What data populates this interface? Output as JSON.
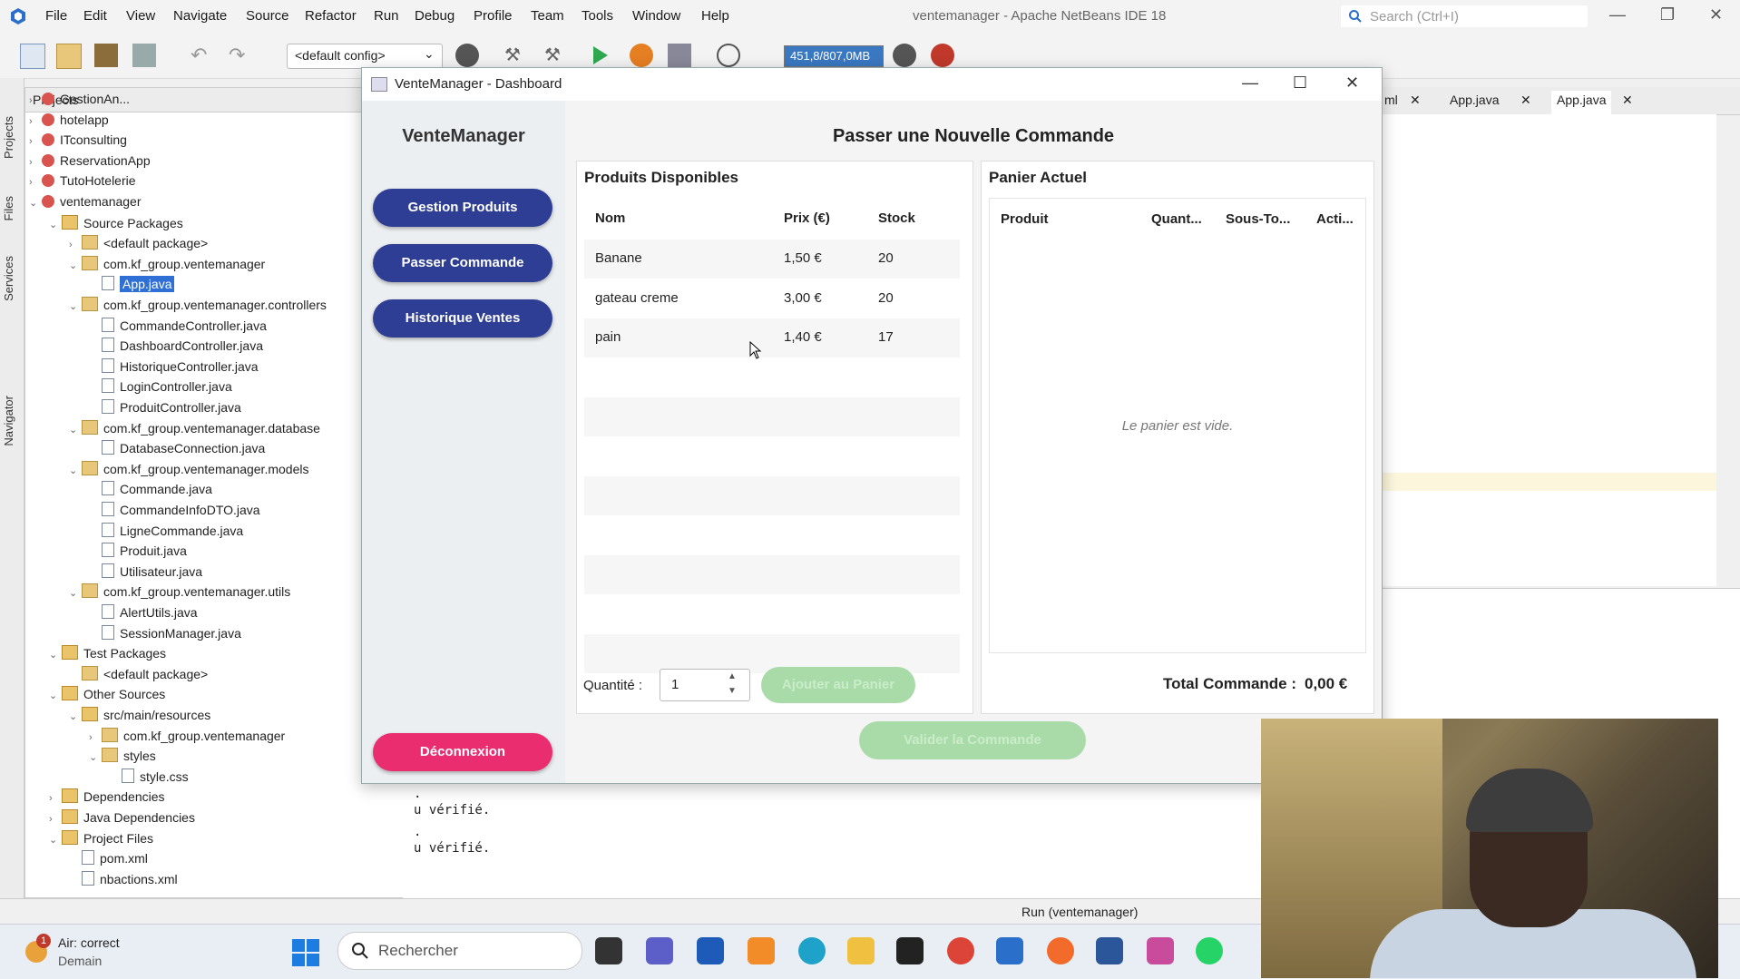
{
  "ide": {
    "title": "ventemanager - Apache NetBeans IDE 18",
    "menus": [
      "File",
      "Edit",
      "View",
      "Navigate",
      "Source",
      "Refactor",
      "Run",
      "Debug",
      "Profile",
      "Team",
      "Tools",
      "Window",
      "Help"
    ],
    "search_placeholder": "Search (Ctrl+I)",
    "config": "<default config>",
    "memory": "451,8/807,0MB",
    "left_tabs": [
      "Projects",
      "Files",
      "Services",
      "Navigator"
    ],
    "projects_header": "Projects",
    "tree": [
      {
        "label": "GestionAn...",
        "indent": 0,
        "icon": "proj",
        "tw": "›"
      },
      {
        "label": "hotelapp",
        "indent": 0,
        "icon": "proj",
        "tw": "›"
      },
      {
        "label": "ITconsulting",
        "indent": 0,
        "icon": "proj",
        "tw": "›"
      },
      {
        "label": "ReservationApp",
        "indent": 0,
        "icon": "proj",
        "tw": "›"
      },
      {
        "label": "TutoHotelerie",
        "indent": 0,
        "icon": "proj",
        "tw": "›"
      },
      {
        "label": "ventemanager",
        "indent": 0,
        "icon": "proj",
        "tw": "⌄"
      },
      {
        "label": "Source Packages",
        "indent": 1,
        "icon": "folder",
        "tw": "⌄"
      },
      {
        "label": "<default package>",
        "indent": 2,
        "icon": "pkg",
        "tw": "›"
      },
      {
        "label": "com.kf_group.ventemanager",
        "indent": 2,
        "icon": "pkg",
        "tw": "⌄"
      },
      {
        "label": "App.java",
        "indent": 3,
        "icon": "file",
        "tw": "",
        "selected": true
      },
      {
        "label": "com.kf_group.ventemanager.controllers",
        "indent": 2,
        "icon": "pkg",
        "tw": "⌄"
      },
      {
        "label": "CommandeController.java",
        "indent": 3,
        "icon": "file",
        "tw": ""
      },
      {
        "label": "DashboardController.java",
        "indent": 3,
        "icon": "file",
        "tw": ""
      },
      {
        "label": "HistoriqueController.java",
        "indent": 3,
        "icon": "file",
        "tw": ""
      },
      {
        "label": "LoginController.java",
        "indent": 3,
        "icon": "file",
        "tw": ""
      },
      {
        "label": "ProduitController.java",
        "indent": 3,
        "icon": "file",
        "tw": ""
      },
      {
        "label": "com.kf_group.ventemanager.database",
        "indent": 2,
        "icon": "pkg",
        "tw": "⌄"
      },
      {
        "label": "DatabaseConnection.java",
        "indent": 3,
        "icon": "file",
        "tw": ""
      },
      {
        "label": "com.kf_group.ventemanager.models",
        "indent": 2,
        "icon": "pkg",
        "tw": "⌄"
      },
      {
        "label": "Commande.java",
        "indent": 3,
        "icon": "file",
        "tw": ""
      },
      {
        "label": "CommandeInfoDTO.java",
        "indent": 3,
        "icon": "file",
        "tw": ""
      },
      {
        "label": "LigneCommande.java",
        "indent": 3,
        "icon": "file",
        "tw": ""
      },
      {
        "label": "Produit.java",
        "indent": 3,
        "icon": "file",
        "tw": ""
      },
      {
        "label": "Utilisateur.java",
        "indent": 3,
        "icon": "file",
        "tw": ""
      },
      {
        "label": "com.kf_group.ventemanager.utils",
        "indent": 2,
        "icon": "pkg",
        "tw": "⌄"
      },
      {
        "label": "AlertUtils.java",
        "indent": 3,
        "icon": "file",
        "tw": ""
      },
      {
        "label": "SessionManager.java",
        "indent": 3,
        "icon": "file",
        "tw": ""
      },
      {
        "label": "Test Packages",
        "indent": 1,
        "icon": "folder",
        "tw": "⌄"
      },
      {
        "label": "<default package>",
        "indent": 2,
        "icon": "pkg",
        "tw": ""
      },
      {
        "label": "Other Sources",
        "indent": 1,
        "icon": "folder",
        "tw": "⌄"
      },
      {
        "label": "src/main/resources",
        "indent": 2,
        "icon": "folder",
        "tw": "⌄"
      },
      {
        "label": "com.kf_group.ventemanager",
        "indent": 3,
        "icon": "pkg",
        "tw": "›"
      },
      {
        "label": "styles",
        "indent": 3,
        "icon": "pkg",
        "tw": "⌄"
      },
      {
        "label": "style.css",
        "indent": 4,
        "icon": "file",
        "tw": ""
      },
      {
        "label": "Dependencies",
        "indent": 1,
        "icon": "folder",
        "tw": "›"
      },
      {
        "label": "Java Dependencies",
        "indent": 1,
        "icon": "folder",
        "tw": "›"
      },
      {
        "label": "Project Files",
        "indent": 1,
        "icon": "folder",
        "tw": "⌄"
      },
      {
        "label": "pom.xml",
        "indent": 2,
        "icon": "file",
        "tw": ""
      },
      {
        "label": "nbactions.xml",
        "indent": 2,
        "icon": "file",
        "tw": ""
      }
    ],
    "editor_tabs": [
      "ml",
      "App.java",
      "App.java"
    ],
    "output_lines": [
      ".",
      "u vérifié.",
      ".",
      "u vérifié."
    ],
    "status_run": "Run (ventemanager)"
  },
  "taskbar": {
    "weather_title": "Air: correct",
    "weather_sub": "Demain",
    "weather_badge": "1",
    "search": "Rechercher"
  },
  "app": {
    "window_title": "VenteManager - Dashboard",
    "brand": "VenteManager",
    "nav": {
      "products": "Gestion Produits",
      "order": "Passer Commande",
      "history": "Historique Ventes",
      "logout": "Déconnexion"
    },
    "page_title": "Passer une Nouvelle Commande",
    "products_panel": {
      "title": "Produits Disponibles",
      "columns": [
        "Nom",
        "Prix (€)",
        "Stock"
      ],
      "rows": [
        {
          "name": "Banane",
          "price": "1,50 €",
          "stock": "20"
        },
        {
          "name": "gateau creme",
          "price": "3,00 €",
          "stock": "20"
        },
        {
          "name": "pain",
          "price": "1,40 €",
          "stock": "17"
        }
      ]
    },
    "cart_panel": {
      "title": "Panier Actuel",
      "columns": [
        "Produit",
        "Quant...",
        "Sous-To...",
        "Acti..."
      ],
      "empty": "Le panier est vide."
    },
    "quantity_label": "Quantité :",
    "quantity_value": "1",
    "add_to_cart": "Ajouter au Panier",
    "total_label": "Total Commande :",
    "total_value": "0,00 €",
    "validate": "Valider la Commande"
  },
  "colors": {
    "nav_button": "#2f3e95",
    "logout_button": "#ea2d6f",
    "disabled_green": "#a9dba9"
  }
}
